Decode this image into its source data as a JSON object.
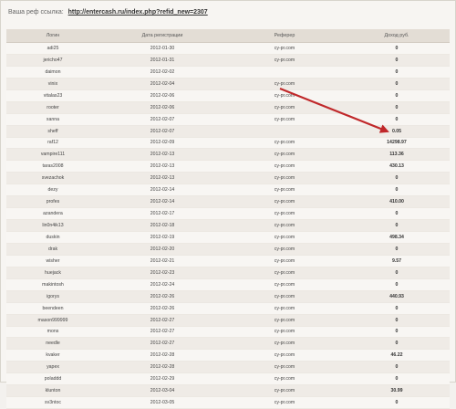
{
  "referral": {
    "label": "Ваша реф ссылка:",
    "link": "http://entercash.ru/index.php?refid_new=2307"
  },
  "table": {
    "headers": [
      "Логин",
      "Дата регистрации",
      "Реферер",
      "Доход руб."
    ],
    "rows": [
      {
        "login": "adi25",
        "date": "2012-01-30",
        "referer": "cy-pr.com",
        "income": "0"
      },
      {
        "login": "jericho47",
        "date": "2012-01-31",
        "referer": "cy-pr.com",
        "income": "0"
      },
      {
        "login": "daimon",
        "date": "2012-02-02",
        "referer": "",
        "income": "0"
      },
      {
        "login": "vinix",
        "date": "2012-02-04",
        "referer": "cy-pr.com",
        "income": "0"
      },
      {
        "login": "vitalas23",
        "date": "2012-02-06",
        "referer": "cy-pr.com",
        "income": "0"
      },
      {
        "login": "rooter",
        "date": "2012-02-06",
        "referer": "cy-pr.com",
        "income": "0"
      },
      {
        "login": "xanna",
        "date": "2012-02-07",
        "referer": "cy-pr.com",
        "income": "0"
      },
      {
        "login": "sheff",
        "date": "2012-02-07",
        "referer": "",
        "income": "0.05"
      },
      {
        "login": "raf12",
        "date": "2012-02-09",
        "referer": "cy-pr.com",
        "income": "14298.97"
      },
      {
        "login": "vampire111",
        "date": "2012-02-13",
        "referer": "cy-pr.com",
        "income": "113.36"
      },
      {
        "login": "taras2008",
        "date": "2012-02-13",
        "referer": "cy-pr.com",
        "income": "430.13"
      },
      {
        "login": "svezachok",
        "date": "2012-02-13",
        "referer": "cy-pr.com",
        "income": "0"
      },
      {
        "login": "dezy",
        "date": "2012-02-14",
        "referer": "cy-pr.com",
        "income": "0"
      },
      {
        "login": "profes",
        "date": "2012-02-14",
        "referer": "cy-pr.com",
        "income": "410.00"
      },
      {
        "login": "azandera",
        "date": "2012-02-17",
        "referer": "cy-pr.com",
        "income": "0"
      },
      {
        "login": "lin0n4ik13",
        "date": "2012-02-18",
        "referer": "cy-pr.com",
        "income": "0"
      },
      {
        "login": "duskin",
        "date": "2012-02-19",
        "referer": "cy-pr.com",
        "income": "498.34"
      },
      {
        "login": "drak",
        "date": "2012-02-20",
        "referer": "cy-pr.com",
        "income": "0"
      },
      {
        "login": "wisher",
        "date": "2012-02-21",
        "referer": "cy-pr.com",
        "income": "9.57"
      },
      {
        "login": "huejack",
        "date": "2012-02-23",
        "referer": "cy-pr.com",
        "income": "0"
      },
      {
        "login": "makintosh",
        "date": "2012-02-24",
        "referer": "cy-pr.com",
        "income": "0"
      },
      {
        "login": "igorys",
        "date": "2012-02-26",
        "referer": "cy-pr.com",
        "income": "440.93"
      },
      {
        "login": "beendeen",
        "date": "2012-02-26",
        "referer": "cy-pr.com",
        "income": "0"
      },
      {
        "login": "mason999999",
        "date": "2012-02-27",
        "referer": "cy-pr.com",
        "income": "0"
      },
      {
        "login": "mons",
        "date": "2012-02-27",
        "referer": "cy-pr.com",
        "income": "0"
      },
      {
        "login": "needle",
        "date": "2012-02-27",
        "referer": "cy-pr.com",
        "income": "0"
      },
      {
        "login": "kvaker",
        "date": "2012-02-28",
        "referer": "cy-pr.com",
        "income": "46.22"
      },
      {
        "login": "yapex",
        "date": "2012-02-28",
        "referer": "cy-pr.com",
        "income": "0"
      },
      {
        "login": "poladdd",
        "date": "2012-02-29",
        "referer": "cy-pr.com",
        "income": "0"
      },
      {
        "login": "klunton",
        "date": "2012-03-04",
        "referer": "cy-pr.com",
        "income": "30.99"
      },
      {
        "login": "sv3ntoc",
        "date": "2012-03-05",
        "referer": "cy-pr.com",
        "income": "0"
      }
    ]
  },
  "colors": {
    "arrow": "#c0282a",
    "header_bg": "#e3ddd5"
  },
  "annotation": {
    "icon": "red-arrow-icon"
  }
}
